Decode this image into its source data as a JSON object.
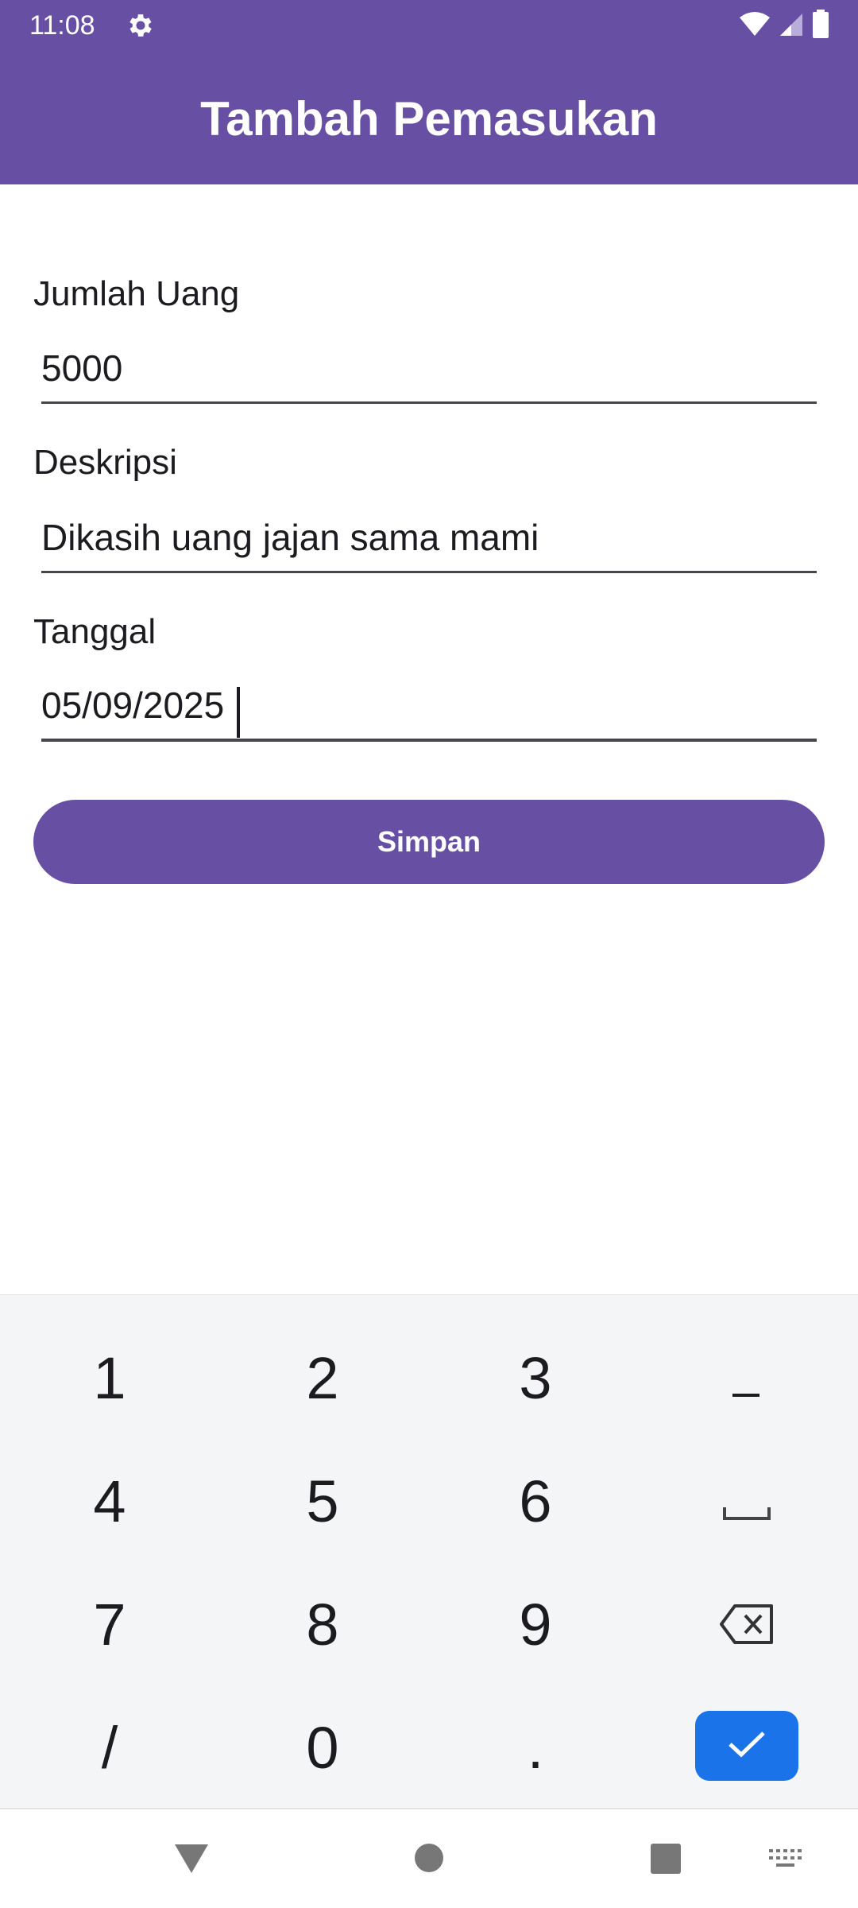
{
  "status_bar": {
    "time": "11:08",
    "icons": [
      "gear-icon",
      "wifi-icon",
      "cell-signal-icon",
      "battery-icon"
    ]
  },
  "header": {
    "title": "Tambah Pemasukan",
    "background_color": "#6750a4"
  },
  "form": {
    "amount": {
      "label": "Jumlah Uang",
      "value": "5000"
    },
    "description": {
      "label": "Deskripsi",
      "value": "Dikasih uang jajan sama mami"
    },
    "date": {
      "label": "Tanggal",
      "value": "05/09/2025"
    },
    "save_label": "Simpan"
  },
  "keyboard": {
    "keys": [
      "1",
      "2",
      "3",
      "–",
      "4",
      "5",
      "6",
      "␣",
      "7",
      "8",
      "9",
      "⌫",
      "/",
      "0",
      ".",
      "✓"
    ],
    "special_icons": [
      "dash-icon",
      "space-icon",
      "backspace-icon",
      "check-icon"
    ],
    "accent_color": "#1a73e8"
  },
  "nav_bar": {
    "icons": [
      "back-triangle-icon",
      "home-circle-icon",
      "recents-square-icon",
      "keyboard-switch-icon"
    ]
  }
}
